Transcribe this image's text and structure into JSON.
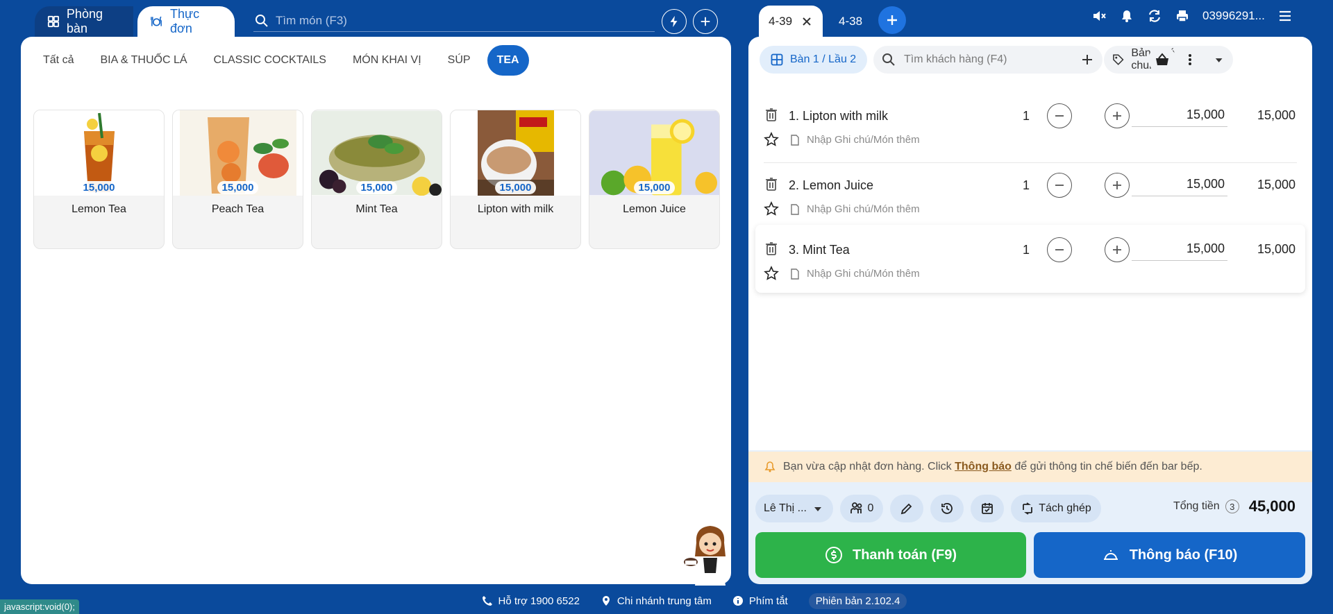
{
  "left_tabs": {
    "rooms": "Phòng bàn",
    "menu": "Thực đơn"
  },
  "search": {
    "placeholder": "Tìm món (F3)"
  },
  "categories": [
    "Tất cả",
    "BIA & THUỐC LÁ",
    "CLASSIC COCKTAILS",
    "MÓN KHAI VỊ",
    "SÚP",
    "TEA"
  ],
  "active_category": "TEA",
  "products": [
    {
      "name": "Lemon Tea",
      "price": "15,000"
    },
    {
      "name": "Peach Tea",
      "price": "15,000"
    },
    {
      "name": "Mint Tea",
      "price": "15,000"
    },
    {
      "name": "Lipton with milk",
      "price": "15,000"
    },
    {
      "name": "Lemon Juice",
      "price": "15,000"
    }
  ],
  "order_tabs": [
    "4-39",
    "4-38"
  ],
  "phone": "03996291...",
  "order": {
    "table": "Bàn 1 / Lầu 2",
    "customer_placeholder": "Tìm khách hàng (F4)",
    "price_list": "Bảng giá chung",
    "note_placeholder": "Nhập Ghi chú/Món thêm",
    "items": [
      {
        "name": "1. Lipton with milk",
        "qty": "1",
        "price": "15,000",
        "total": "15,000"
      },
      {
        "name": "2. Lemon Juice",
        "qty": "1",
        "price": "15,000",
        "total": "15,000"
      },
      {
        "name": "3. Mint Tea",
        "qty": "1",
        "price": "15,000",
        "total": "15,000"
      }
    ]
  },
  "notice": {
    "before": "Bạn vừa cập nhật đơn hàng. Click ",
    "link": "Thông báo",
    "after": " để gửi thông tin chế biến đến bar bếp."
  },
  "toolbar": {
    "staff": "Lê Thị ...",
    "guests": "0",
    "split": "Tách ghép"
  },
  "totals": {
    "label": "Tổng tiền",
    "count": "3",
    "value": "45,000"
  },
  "actions": {
    "pay": "Thanh toán (F9)",
    "notify": "Thông báo (F10)"
  },
  "footer": {
    "support": "Hỗ trợ 1900 6522",
    "branch": "Chi nhánh trung tâm",
    "shortcuts": "Phím tắt",
    "version": "Phiên bản 2.102.4"
  },
  "status_bar": "javascript:void(0);",
  "colors": {
    "primary": "#1566c8",
    "background": "#0a4a9c",
    "pay": "#2db34a",
    "notice_bg": "#fdecd3"
  }
}
